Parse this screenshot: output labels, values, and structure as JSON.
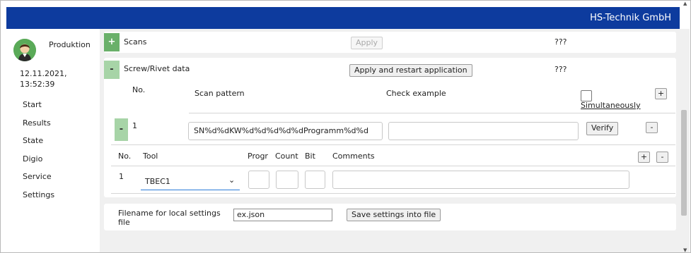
{
  "header": {
    "brand": "HS-Technik GmbH"
  },
  "sidebar": {
    "user_name": "Produktion",
    "date": "12.11.2021,",
    "time": "13:52:39",
    "items": [
      {
        "label": "Start"
      },
      {
        "label": "Results"
      },
      {
        "label": "State"
      },
      {
        "label": "Digio"
      },
      {
        "label": "Service"
      },
      {
        "label": "Settings"
      }
    ]
  },
  "scans": {
    "toggle": "+",
    "title": "Scans",
    "apply_label": "Apply",
    "status": "???"
  },
  "screw": {
    "toggle": "-",
    "title": "Screw/Rivet data",
    "apply_label": "Apply and restart application",
    "status": "???",
    "headers": {
      "no": "No.",
      "scan_pattern": "Scan pattern",
      "check_example": "Check example",
      "simultaneously": "Simultaneously",
      "add": "+"
    },
    "row": {
      "toggle": "-",
      "no": "1",
      "scan_pattern": "SN%d%dKW%d%d%d%d%dProgramm%d%d",
      "check_example": "",
      "verify_label": "Verify",
      "remove": "-"
    },
    "tools": {
      "headers": {
        "no": "No.",
        "tool": "Tool",
        "progr": "Progr",
        "count": "Count",
        "bit": "Bit",
        "comments": "Comments",
        "add": "+",
        "remove": "-"
      },
      "row": {
        "no": "1",
        "tool": "TBEC1",
        "progr": "",
        "count": "",
        "bit": "",
        "comments": ""
      }
    }
  },
  "settings_file": {
    "label_line1": "Filename for local settings",
    "label_line2": "file",
    "filename": "ex.json",
    "save_label": "Save settings into file"
  }
}
